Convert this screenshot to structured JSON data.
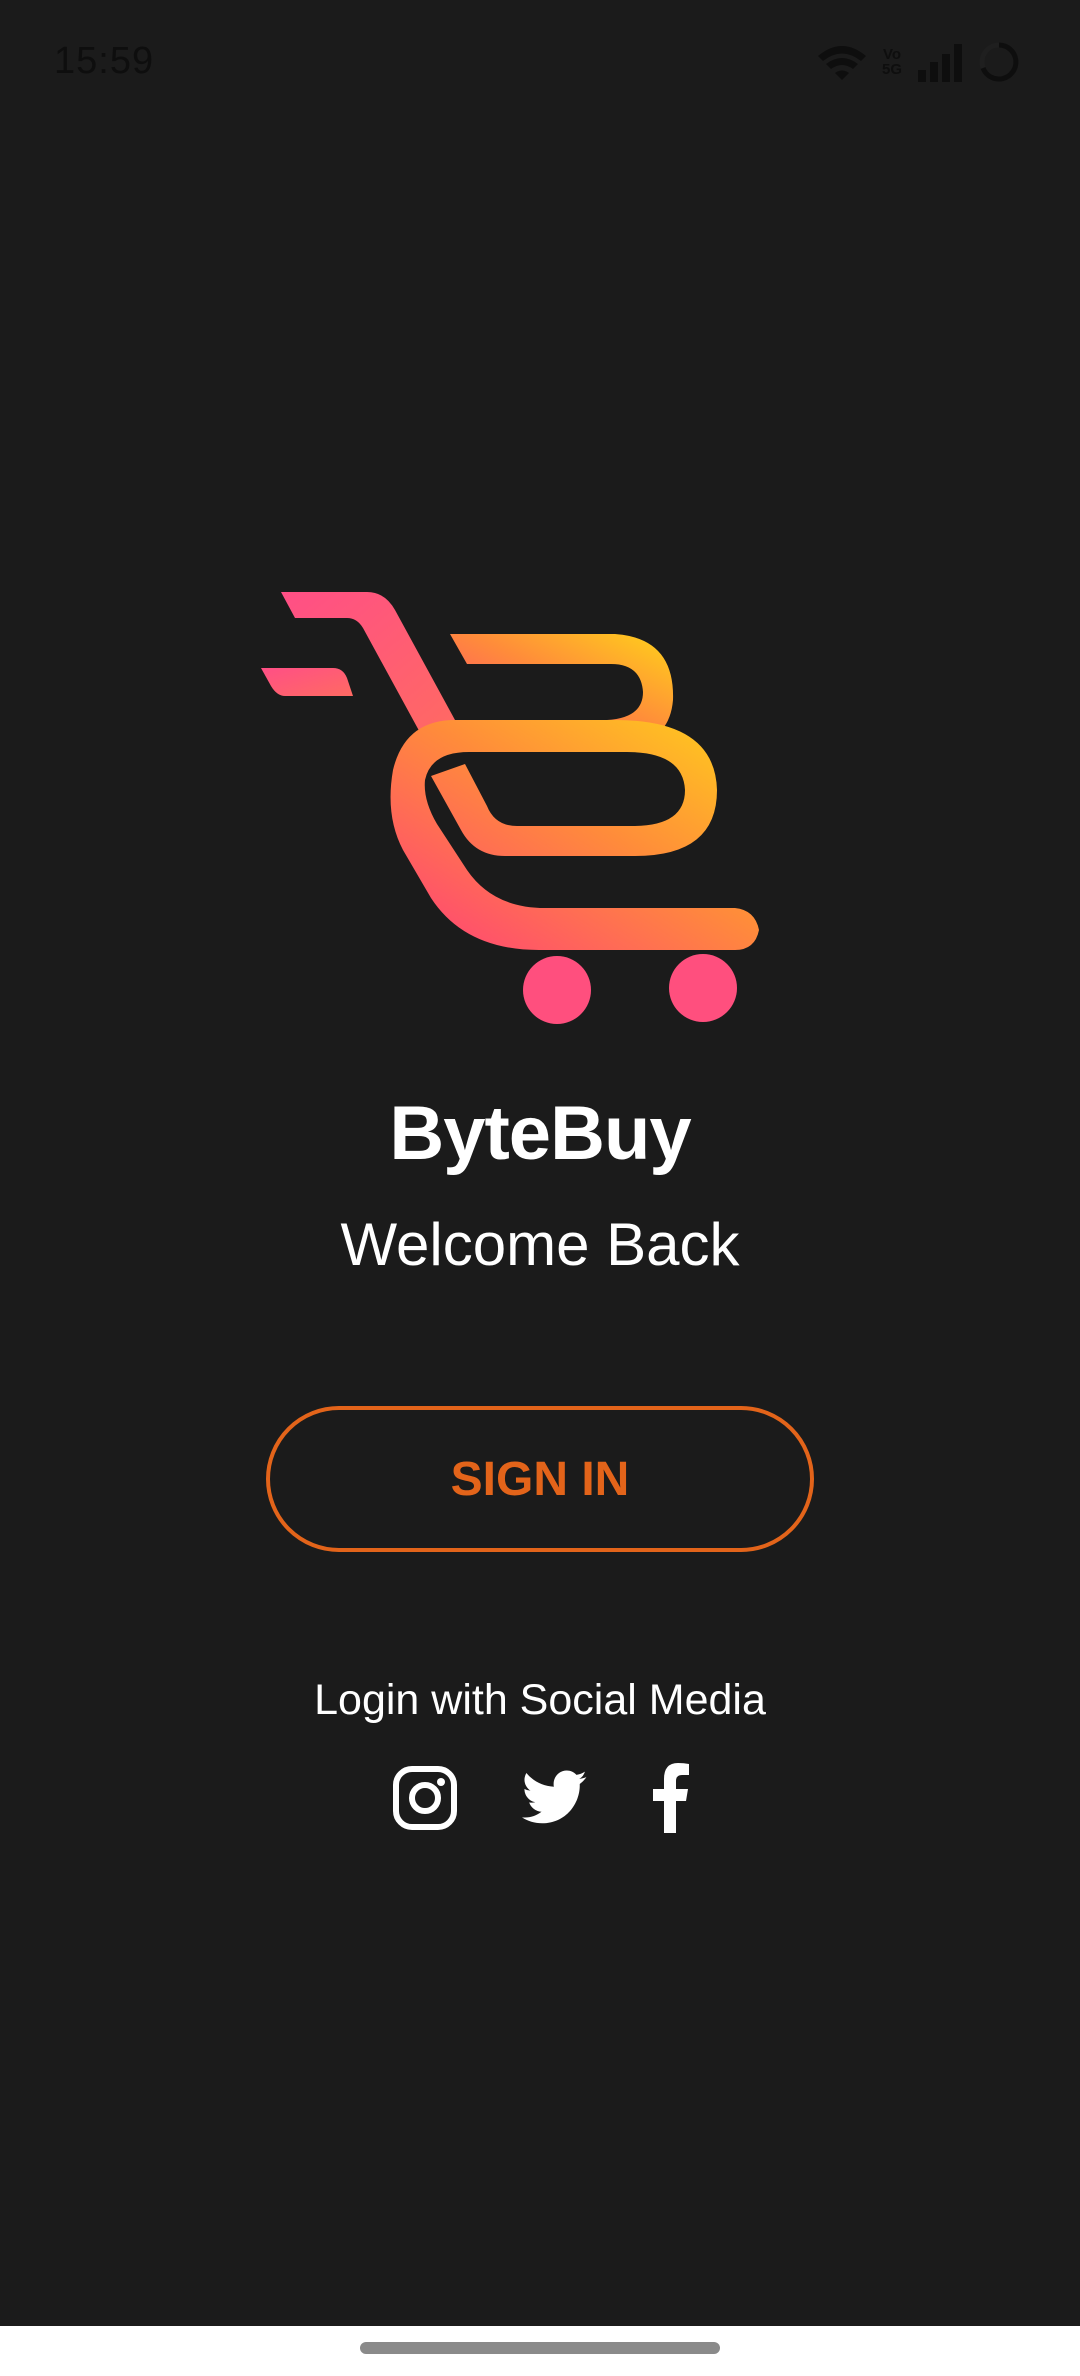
{
  "status_bar": {
    "time": "15:59",
    "volte_top": "Vo",
    "volte_bottom": "5G",
    "icons": [
      "wifi-icon",
      "volte-5g-icon",
      "signal-icon",
      "loading-ring-icon"
    ]
  },
  "app": {
    "name": "ByteBuy",
    "welcome_text": "Welcome Back",
    "logo_icon": "shopping-cart-logo",
    "colors": {
      "background": "#1b1b1b",
      "accent": "#e3641a",
      "logo_gradient_start": "#ff3f7a",
      "logo_gradient_mid": "#ff8c3a",
      "logo_gradient_end": "#ffd21a"
    }
  },
  "sign_in": {
    "label": "SIGN IN"
  },
  "social": {
    "caption": "Login with Social Media",
    "providers": [
      "instagram-icon",
      "twitter-icon",
      "facebook-icon"
    ]
  }
}
